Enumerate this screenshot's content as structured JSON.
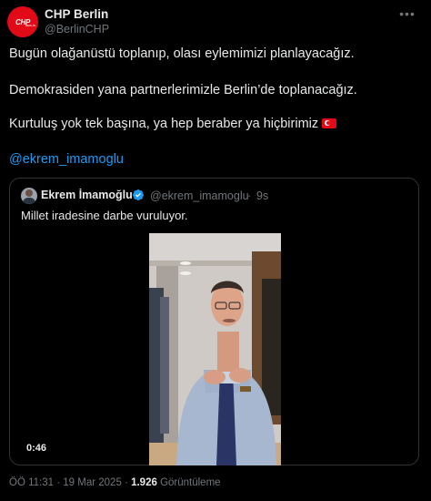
{
  "author": {
    "name": "CHP Berlin",
    "handle": "@BerlinCHP",
    "avatar_text": "CHP",
    "avatar_sub": "BERLİN"
  },
  "tweet": {
    "line1": "Bugün olağanüstü toplanıp, olası eylemimizi planlayacağız.",
    "line2": "Demokrasiden yana partnerlerimizle Berlin’de toplanacağız.",
    "line3": "Kurtuluş yok tek başına, ya hep beraber ya hiçbirimiz",
    "mention": "@ekrem_imamoglu"
  },
  "quoted": {
    "name": "Ekrem İmamoğlu",
    "handle": "@ekrem_imamoglu",
    "separator": "·",
    "time": "9s",
    "text": "Millet iradesine darbe vuruluyor.",
    "video_duration": "0:46"
  },
  "meta": {
    "time": "ÖÖ 11:31",
    "sep1": "·",
    "date": "19 Mar 2025",
    "sep2": "·",
    "views_count": "1.926",
    "views_label": "Görüntüleme"
  },
  "icons": {
    "more": "more-icon",
    "verified": "verified-badge-icon",
    "flag": "turkey-flag-icon"
  },
  "colors": {
    "background": "#000000",
    "link": "#1d9bf0",
    "muted": "#71767b",
    "brand_red": "#e30a17"
  }
}
